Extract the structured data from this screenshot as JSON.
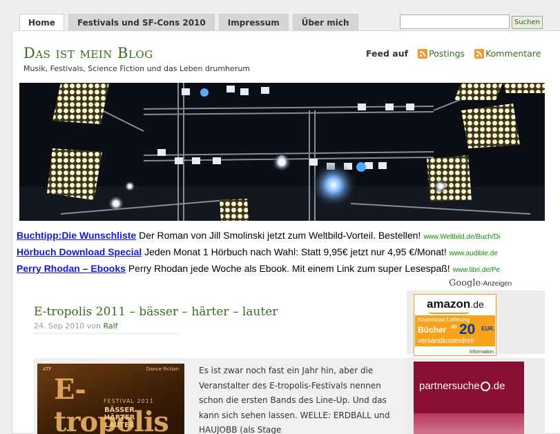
{
  "nav": {
    "tabs": [
      {
        "label": "Home",
        "active": true
      },
      {
        "label": "Festivals und SF-Cons 2010"
      },
      {
        "label": "Impressum"
      },
      {
        "label": "Über mich"
      }
    ],
    "search_button": "Suchen",
    "search_value": ""
  },
  "header": {
    "title": "Das ist mein Blog",
    "tagline": "Musik, Festivals, Science Fiction und das Leben drumherum",
    "feed_label": "Feed auf",
    "feed_posts": "Postings",
    "feed_comments": "Kommentare"
  },
  "ads": [
    {
      "link": "Buchtipp:Die Wunschliste",
      "text": " Der Roman von Jill Smolinski jetzt zum Weltbild-Vorteil. Bestellen!",
      "url": "www.Weltbild.de/Buch/Di"
    },
    {
      "link": "Hörbuch Download Special",
      "text": " Jeden Monat 1 Hörbuch nach Wahl: Statt 9,95€ jetzt nur 4,95 €/Monat!",
      "url": "www.audible.de"
    },
    {
      "link": "Perry Rhodan – Ebooks",
      "text": " Perry Rhodan jede Woche als Ebook. Mit einem Link zum super Lesespaß!",
      "url": "www.libri.de/Pe"
    }
  ],
  "google_ads": {
    "brand": "Google",
    "label": "-Anzeigen"
  },
  "post": {
    "title": "E-tropolis 2011 – bässer – härter – lauter",
    "date": "24. Sep 2010",
    "by": "von",
    "author": "Ralf",
    "text": "Es ist zwar noch fast ein Jahr hin, aber die Veranstalter des E-tropolis-Festivals nennen schon die ersten Bands des Line-Up. Und das kann sich sehen lassen. WELLE: ERDBALL und HAUJOBB (als Stage",
    "cover": {
      "logo": "E-tropolis",
      "festival": "FESTIVAL 2011",
      "slogan": [
        "BÄSSER",
        "HÄRTER",
        "LAUTER"
      ],
      "top_left": "ATF",
      "top_right": "Dance Fiction"
    }
  },
  "sidebar": {
    "amazon": {
      "brand": "amazon",
      "tld": ".de",
      "line1": "Kostenlose Lieferung",
      "line2": "Bücher",
      "ab": "ab",
      "amount": "20",
      "currency": "EUR.",
      "line3": "versandkostenfrei!",
      "info": "Information"
    },
    "partner": {
      "name_a": "partnersuche",
      "name_b": ".de"
    }
  }
}
